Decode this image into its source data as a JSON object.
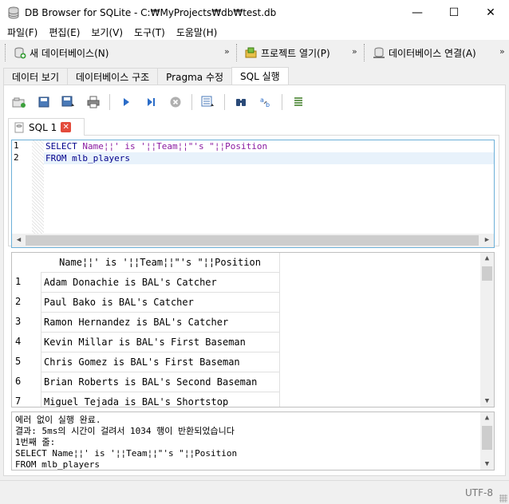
{
  "window": {
    "title": "DB Browser for SQLite - C:₩MyProjects₩db₩test.db",
    "minimize": "—",
    "maximize": "☐",
    "close": "✕"
  },
  "menu": [
    "파일(F)",
    "편집(E)",
    "보기(V)",
    "도구(T)",
    "도움말(H)"
  ],
  "toolbar": {
    "new_db": "새 데이터베이스(N)",
    "open_project": "프로젝트 열기(P)",
    "connect_db": "데이터베이스 연결(A)",
    "overflow": "»"
  },
  "tabs": [
    "데이터 보기",
    "데이터베이스 구조",
    "Pragma 수정",
    "SQL 실행"
  ],
  "active_tab": "SQL 실행",
  "sql_tab": {
    "label": "SQL 1",
    "close": "✕"
  },
  "editor": {
    "lines": [
      {
        "num": "1",
        "kw": "SELECT ",
        "rest": "Name¦¦' is '¦¦Team¦¦\"'s \"¦¦Position"
      },
      {
        "num": "2",
        "kw": "FROM ",
        "rest": "mlb_players"
      }
    ]
  },
  "results": {
    "column": "Name¦¦' is '¦¦Team¦¦\"'s \"¦¦Position",
    "rows": [
      {
        "n": "1",
        "value": "Adam Donachie is BAL's Catcher"
      },
      {
        "n": "2",
        "value": "Paul Bako is BAL's Catcher"
      },
      {
        "n": "3",
        "value": "Ramon Hernandez is BAL's Catcher"
      },
      {
        "n": "4",
        "value": "Kevin Millar is BAL's First Baseman"
      },
      {
        "n": "5",
        "value": "Chris Gomez is BAL's First Baseman"
      },
      {
        "n": "6",
        "value": "Brian Roberts is BAL's Second Baseman"
      },
      {
        "n": "7",
        "value": "Miguel Tejada is BAL's Shortstop"
      }
    ]
  },
  "messages": [
    "에러 없이 실행 완료.",
    "결과: 5ms의 시간이 걸려서 1034 행이 반환되었습니다",
    "1번째 줄:",
    "SELECT Name¦¦' is '¦¦Team¦¦\"'s \"¦¦Position",
    "FROM mlb_players"
  ],
  "status": {
    "encoding": "UTF-8"
  },
  "colors": {
    "keyword": "#00008b",
    "identifier": "#8a1aa0",
    "editor_border": "#6cb0d8",
    "close_red": "#e34b3b"
  }
}
